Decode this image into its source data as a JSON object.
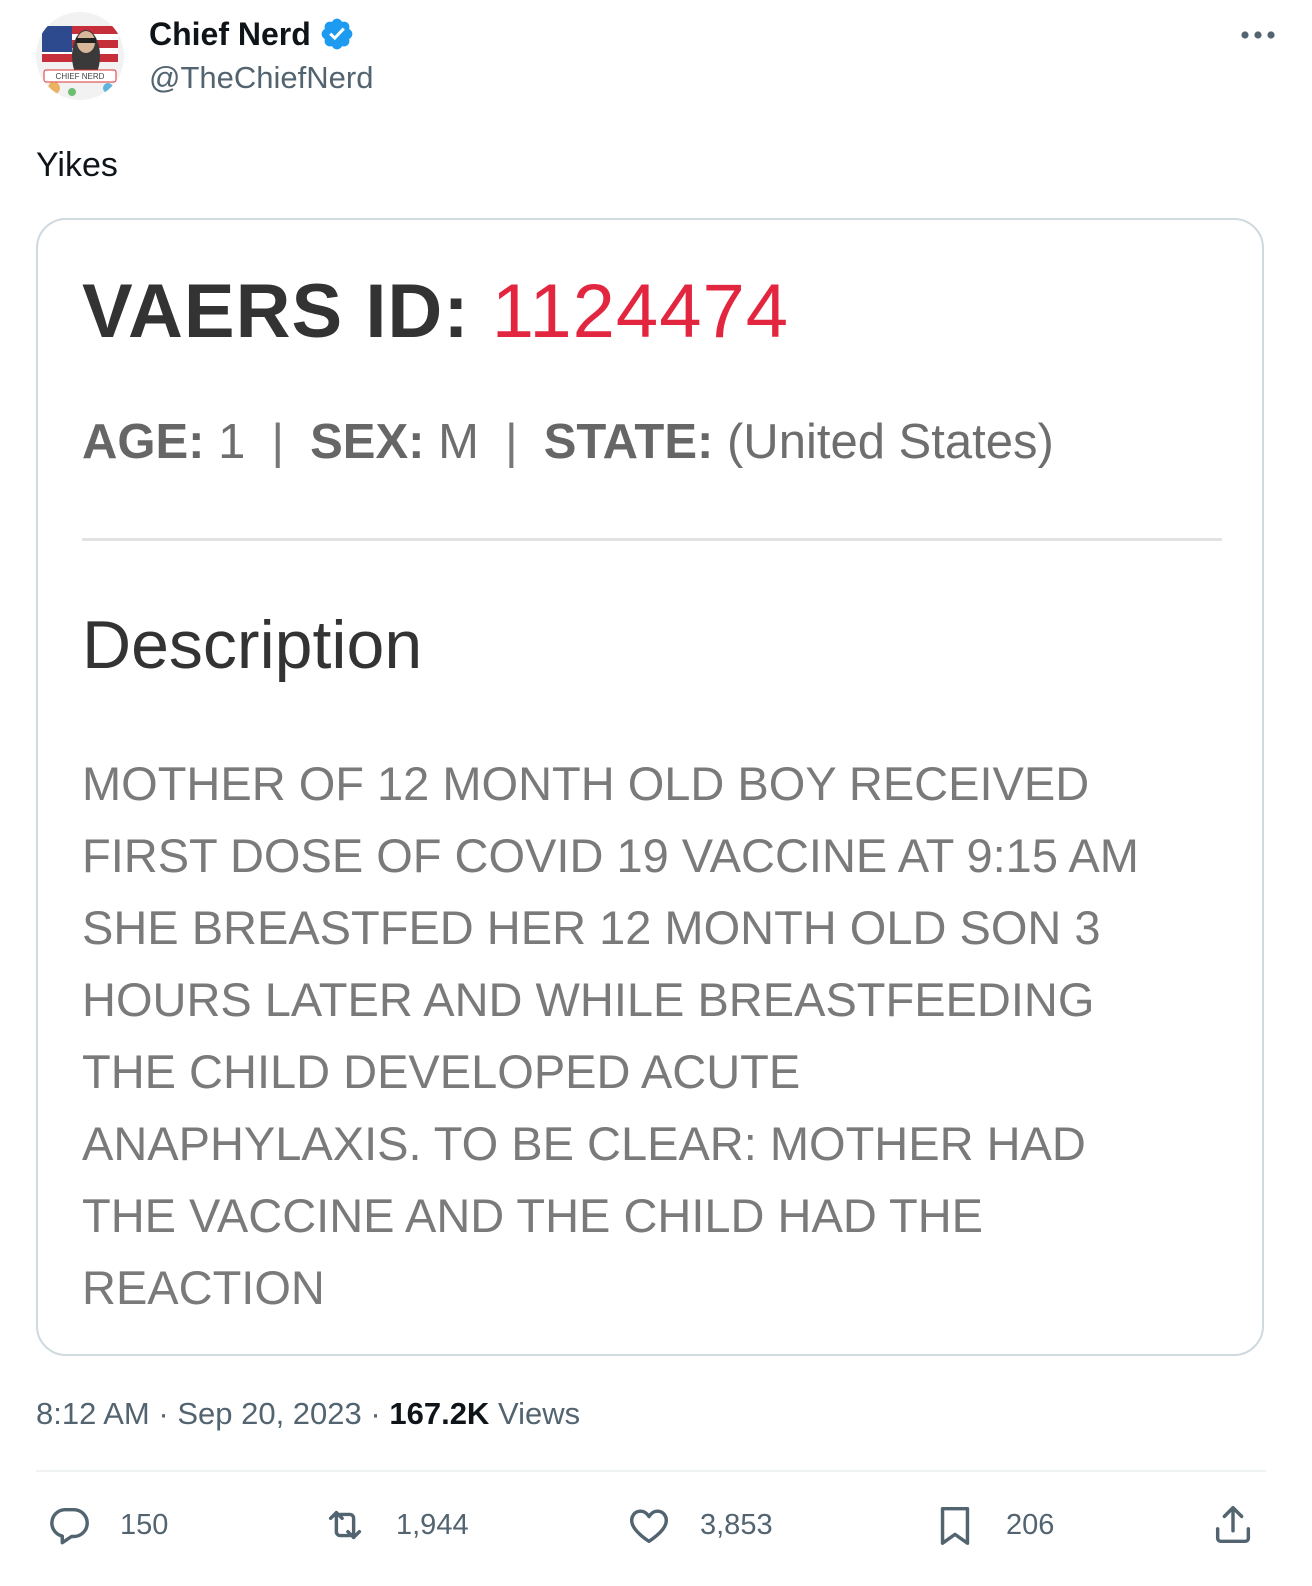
{
  "author": {
    "display_name": "Chief Nerd",
    "handle": "@TheChiefNerd",
    "verified": true,
    "avatar_icon": "avatar-icon",
    "avatar_label": "CHIEF NERD"
  },
  "tweet": {
    "text": "Yikes"
  },
  "media": {
    "vaers_label": "VAERS ID:",
    "vaers_id": "1124474",
    "vaers_id_color": "#e3263f",
    "age_label": "AGE:",
    "age_value": "1",
    "sex_label": "SEX:",
    "sex_value": "M",
    "state_label": "STATE:",
    "state_value": "(United States)",
    "separator": "|",
    "description_heading": "Description",
    "description_lines": [
      "MOTHER OF 12 MONTH OLD BOY RECEIVED",
      "FIRST DOSE OF COVID 19 VACCINE AT 9:15 AM",
      "SHE BREASTFED HER 12 MONTH OLD SON 3",
      "HOURS LATER AND WHILE BREASTFEEDING",
      "THE CHILD DEVELOPED ACUTE",
      "ANAPHYLAXIS. TO BE CLEAR: MOTHER HAD",
      "THE VACCINE AND THE CHILD HAD THE",
      "REACTION"
    ]
  },
  "footer": {
    "time": "8:12 AM",
    "dot": "·",
    "date": "Sep 20, 2023",
    "views_count": "167.2K",
    "views_label": "Views"
  },
  "actions": {
    "replies": "150",
    "retweets": "1,944",
    "likes": "3,853",
    "bookmarks": "206"
  },
  "colors": {
    "verified_badge": "#1d9bf0",
    "secondary_text": "#536471",
    "primary_text": "#0f1419"
  }
}
